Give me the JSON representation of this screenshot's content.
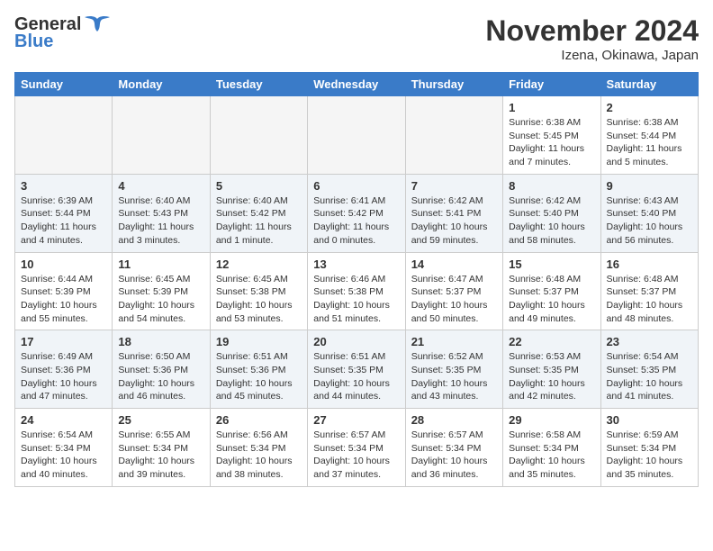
{
  "header": {
    "logo_general": "General",
    "logo_blue": "Blue",
    "month_title": "November 2024",
    "location": "Izena, Okinawa, Japan"
  },
  "calendar": {
    "days_of_week": [
      "Sunday",
      "Monday",
      "Tuesday",
      "Wednesday",
      "Thursday",
      "Friday",
      "Saturday"
    ],
    "weeks": [
      [
        {
          "day": "",
          "info": "",
          "empty": true
        },
        {
          "day": "",
          "info": "",
          "empty": true
        },
        {
          "day": "",
          "info": "",
          "empty": true
        },
        {
          "day": "",
          "info": "",
          "empty": true
        },
        {
          "day": "",
          "info": "",
          "empty": true
        },
        {
          "day": "1",
          "info": "Sunrise: 6:38 AM\nSunset: 5:45 PM\nDaylight: 11 hours and 7 minutes."
        },
        {
          "day": "2",
          "info": "Sunrise: 6:38 AM\nSunset: 5:44 PM\nDaylight: 11 hours and 5 minutes."
        }
      ],
      [
        {
          "day": "3",
          "info": "Sunrise: 6:39 AM\nSunset: 5:44 PM\nDaylight: 11 hours and 4 minutes."
        },
        {
          "day": "4",
          "info": "Sunrise: 6:40 AM\nSunset: 5:43 PM\nDaylight: 11 hours and 3 minutes."
        },
        {
          "day": "5",
          "info": "Sunrise: 6:40 AM\nSunset: 5:42 PM\nDaylight: 11 hours and 1 minute."
        },
        {
          "day": "6",
          "info": "Sunrise: 6:41 AM\nSunset: 5:42 PM\nDaylight: 11 hours and 0 minutes."
        },
        {
          "day": "7",
          "info": "Sunrise: 6:42 AM\nSunset: 5:41 PM\nDaylight: 10 hours and 59 minutes."
        },
        {
          "day": "8",
          "info": "Sunrise: 6:42 AM\nSunset: 5:40 PM\nDaylight: 10 hours and 58 minutes."
        },
        {
          "day": "9",
          "info": "Sunrise: 6:43 AM\nSunset: 5:40 PM\nDaylight: 10 hours and 56 minutes."
        }
      ],
      [
        {
          "day": "10",
          "info": "Sunrise: 6:44 AM\nSunset: 5:39 PM\nDaylight: 10 hours and 55 minutes."
        },
        {
          "day": "11",
          "info": "Sunrise: 6:45 AM\nSunset: 5:39 PM\nDaylight: 10 hours and 54 minutes."
        },
        {
          "day": "12",
          "info": "Sunrise: 6:45 AM\nSunset: 5:38 PM\nDaylight: 10 hours and 53 minutes."
        },
        {
          "day": "13",
          "info": "Sunrise: 6:46 AM\nSunset: 5:38 PM\nDaylight: 10 hours and 51 minutes."
        },
        {
          "day": "14",
          "info": "Sunrise: 6:47 AM\nSunset: 5:37 PM\nDaylight: 10 hours and 50 minutes."
        },
        {
          "day": "15",
          "info": "Sunrise: 6:48 AM\nSunset: 5:37 PM\nDaylight: 10 hours and 49 minutes."
        },
        {
          "day": "16",
          "info": "Sunrise: 6:48 AM\nSunset: 5:37 PM\nDaylight: 10 hours and 48 minutes."
        }
      ],
      [
        {
          "day": "17",
          "info": "Sunrise: 6:49 AM\nSunset: 5:36 PM\nDaylight: 10 hours and 47 minutes."
        },
        {
          "day": "18",
          "info": "Sunrise: 6:50 AM\nSunset: 5:36 PM\nDaylight: 10 hours and 46 minutes."
        },
        {
          "day": "19",
          "info": "Sunrise: 6:51 AM\nSunset: 5:36 PM\nDaylight: 10 hours and 45 minutes."
        },
        {
          "day": "20",
          "info": "Sunrise: 6:51 AM\nSunset: 5:35 PM\nDaylight: 10 hours and 44 minutes."
        },
        {
          "day": "21",
          "info": "Sunrise: 6:52 AM\nSunset: 5:35 PM\nDaylight: 10 hours and 43 minutes."
        },
        {
          "day": "22",
          "info": "Sunrise: 6:53 AM\nSunset: 5:35 PM\nDaylight: 10 hours and 42 minutes."
        },
        {
          "day": "23",
          "info": "Sunrise: 6:54 AM\nSunset: 5:35 PM\nDaylight: 10 hours and 41 minutes."
        }
      ],
      [
        {
          "day": "24",
          "info": "Sunrise: 6:54 AM\nSunset: 5:34 PM\nDaylight: 10 hours and 40 minutes."
        },
        {
          "day": "25",
          "info": "Sunrise: 6:55 AM\nSunset: 5:34 PM\nDaylight: 10 hours and 39 minutes."
        },
        {
          "day": "26",
          "info": "Sunrise: 6:56 AM\nSunset: 5:34 PM\nDaylight: 10 hours and 38 minutes."
        },
        {
          "day": "27",
          "info": "Sunrise: 6:57 AM\nSunset: 5:34 PM\nDaylight: 10 hours and 37 minutes."
        },
        {
          "day": "28",
          "info": "Sunrise: 6:57 AM\nSunset: 5:34 PM\nDaylight: 10 hours and 36 minutes."
        },
        {
          "day": "29",
          "info": "Sunrise: 6:58 AM\nSunset: 5:34 PM\nDaylight: 10 hours and 35 minutes."
        },
        {
          "day": "30",
          "info": "Sunrise: 6:59 AM\nSunset: 5:34 PM\nDaylight: 10 hours and 35 minutes."
        }
      ]
    ]
  }
}
